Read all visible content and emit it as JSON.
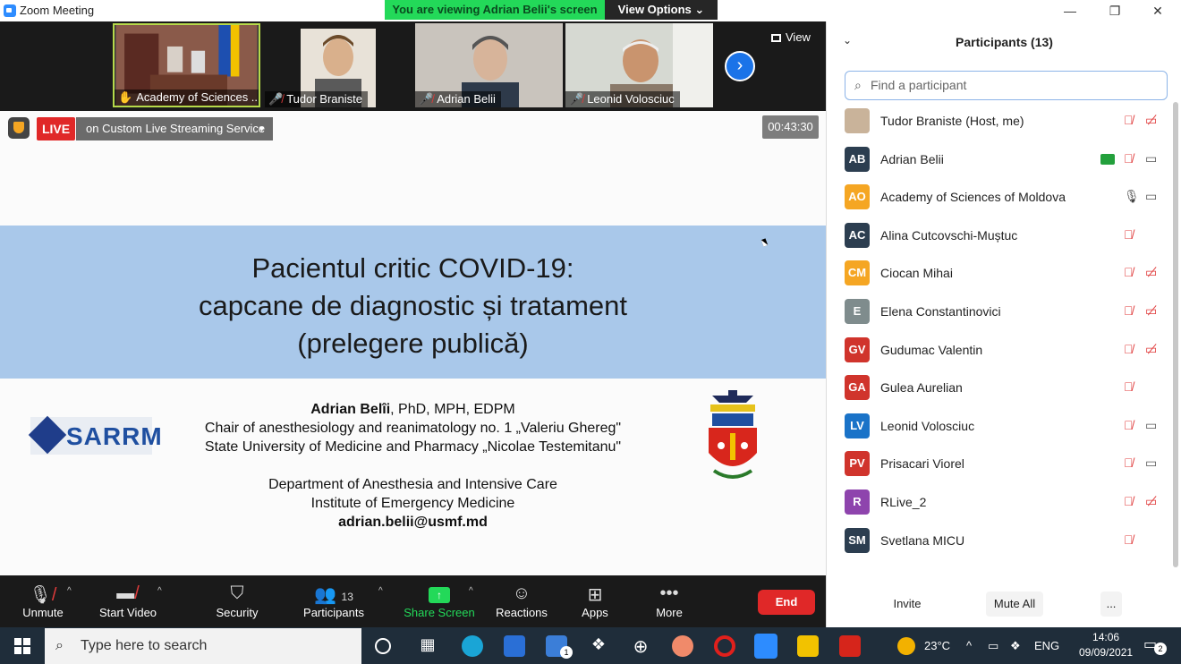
{
  "window": {
    "title": "Zoom Meeting"
  },
  "banner": {
    "viewing": "You are viewing Adrian Belii's screen",
    "view_options": "View Options"
  },
  "window_controls": {
    "minimize": "—",
    "restore": "❐",
    "close": "✕"
  },
  "video_strip": {
    "thumbnails": [
      {
        "name": "Academy of Sciences ...",
        "active": true
      },
      {
        "name": "Tudor Braniste",
        "active": false
      },
      {
        "name": "Adrian Belii",
        "active": false
      },
      {
        "name": "Leonid Volosciuc",
        "active": false
      }
    ],
    "next_glyph": "›",
    "view_label": "View"
  },
  "stream": {
    "live_badge": "LIVE",
    "service": "on Custom Live Streaming Service",
    "timer": "00:43:30"
  },
  "slide": {
    "title_lines": [
      "Pacientul critic COVID-19:",
      "capcane de diagnostic și tratament",
      "(prelegere publică)"
    ],
    "logo_text": "SARRM",
    "presenter_name": "Adrian Belîi",
    "presenter_degrees": ", PhD, MPH, EDPM",
    "line_chair": "Chair of anesthesiology and reanimatology no. 1 „Valeriu Ghereg\"",
    "line_university": "State University of Medicine and Pharmacy „Nicolae Testemitanu\"",
    "line_department": "Department of Anesthesia and Intensive Care",
    "line_institute": "Institute of Emergency Medicine",
    "email": "adrian.belii@usmf.md"
  },
  "toolbar": {
    "unmute": "Unmute",
    "start_video": "Start Video",
    "security": "Security",
    "participants": "Participants",
    "participants_count": "13",
    "share_screen": "Share Screen",
    "reactions": "Reactions",
    "apps": "Apps",
    "more": "More",
    "end": "End"
  },
  "panel": {
    "title": "Participants (13)",
    "search_placeholder": "Find a participant",
    "participants": [
      {
        "initials": "",
        "name": "Tudor Braniste (Host, me)",
        "color": "#c9b39a",
        "mic": "muted",
        "video": "off",
        "share": false
      },
      {
        "initials": "AB",
        "name": "Adrian Belii",
        "color": "#2c3e50",
        "mic": "muted",
        "video": "on",
        "share": true
      },
      {
        "initials": "AO",
        "name": "Academy of Sciences of Moldova",
        "color": "#f5a623",
        "mic": "on",
        "video": "on",
        "share": false
      },
      {
        "initials": "AC",
        "name": "Alina Cutcovschi-Muștuc",
        "color": "#2c3e50",
        "mic": "muted",
        "video": "none",
        "share": false
      },
      {
        "initials": "CM",
        "name": "Ciocan Mihai",
        "color": "#f5a623",
        "mic": "muted",
        "video": "off",
        "share": false
      },
      {
        "initials": "E",
        "name": "Elena Constantinovici",
        "color": "#7f8c8d",
        "mic": "muted",
        "video": "off",
        "share": false
      },
      {
        "initials": "GV",
        "name": "Gudumac Valentin",
        "color": "#d0342c",
        "mic": "muted",
        "video": "off",
        "share": false
      },
      {
        "initials": "GA",
        "name": "Gulea Aurelian",
        "color": "#d0342c",
        "mic": "muted",
        "video": "none",
        "share": false
      },
      {
        "initials": "LV",
        "name": "Leonid Volosciuc",
        "color": "#1a73c8",
        "mic": "muted",
        "video": "on",
        "share": false
      },
      {
        "initials": "PV",
        "name": "Prisacari Viorel",
        "color": "#d0342c",
        "mic": "muted",
        "video": "on",
        "share": false
      },
      {
        "initials": "R",
        "name": "RLive_2",
        "color": "#8e44ad",
        "mic": "muted",
        "video": "off",
        "share": false
      },
      {
        "initials": "SM",
        "name": "Svetlana MICU",
        "color": "#2c3e50",
        "mic": "muted",
        "video": "none",
        "share": false
      }
    ],
    "invite": "Invite",
    "mute_all": "Mute All",
    "more": "..."
  },
  "taskbar": {
    "search_placeholder": "Type here to search",
    "temperature": "23°C",
    "language": "ENG",
    "time": "14:06",
    "date": "09/09/2021",
    "mail_badge": "1",
    "notification_badge": "2"
  },
  "colors": {
    "accent_green": "#23D959",
    "live_red": "#e02828",
    "zoom_blue": "#2D8CFF",
    "title_band": "#a9c8ea"
  }
}
